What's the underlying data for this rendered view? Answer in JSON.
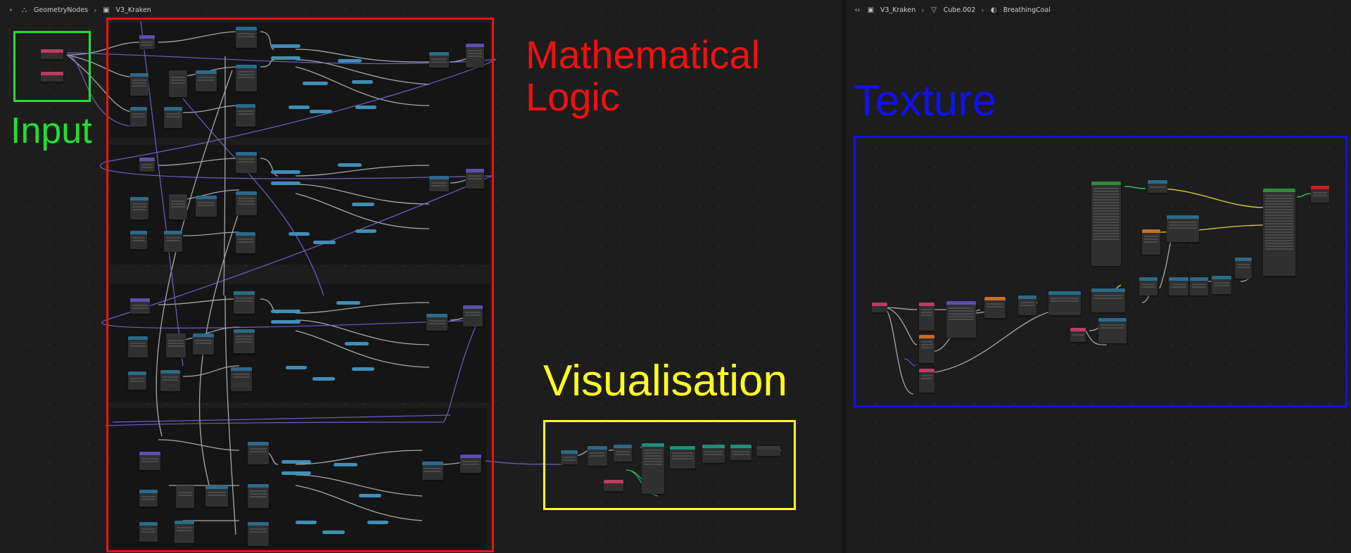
{
  "left_header": {
    "items": [
      {
        "icon": "node-tree-icon",
        "label": "GeometryNodes"
      },
      {
        "icon": "node-group-icon",
        "label": "V3_Kraken"
      }
    ]
  },
  "right_header": {
    "items": [
      {
        "icon": "scene-icon",
        "label": "V3_Kraken"
      },
      {
        "icon": "mesh-icon",
        "label": "Cube.002"
      },
      {
        "icon": "material-icon",
        "label": "BreathingCoal"
      }
    ]
  },
  "annotations": {
    "input": "Input",
    "math_line1": "Mathematical",
    "math_line2": "Logic",
    "visualisation": "Visualisation",
    "texture": "Texture"
  },
  "colors": {
    "input": "#22dd33",
    "math": "#ee1111",
    "visualisation": "#ffff22",
    "texture": "#1111ee",
    "node_header_purple": "#5b4fb0",
    "node_header_blue": "#2a6a8a",
    "node_header_pink": "#c23a63",
    "node_header_teal": "#1f8f7a",
    "node_header_green": "#2e8a3c",
    "node_header_orange": "#c87020",
    "node_header_red": "#b02a2a",
    "math_pill": "#3e8fb8",
    "wire_gray": "#b8b8b8",
    "wire_purple": "#7b6fe0",
    "wire_yellow": "#d8d23a",
    "wire_green": "#3ccf6a"
  }
}
